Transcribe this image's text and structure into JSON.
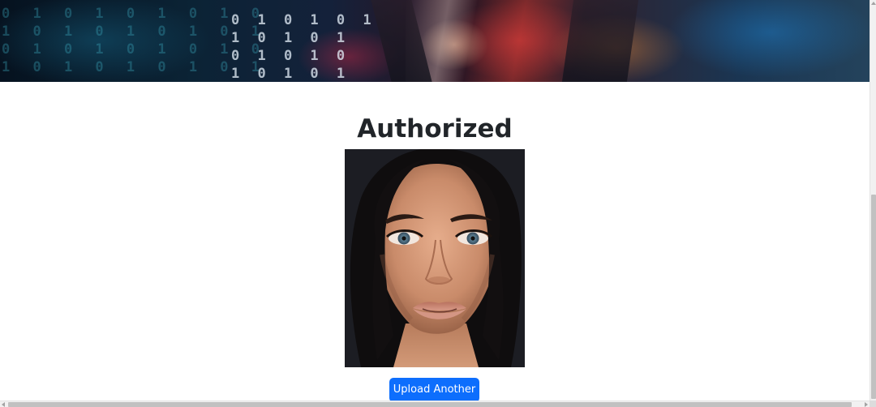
{
  "hero": {
    "digits_left": "0 1 0 1 0 1 0 1 0\n1 0 1 0 1 0 1 0 1\n0 1 0 1 0 1 0 1 0\n1 0 1 0 1 0 1 0 1",
    "digits_center": "0 1 0 1 0 1\n1 0 1 0 1\n0 1 0 1 0\n1 0 1 0 1"
  },
  "result": {
    "title": "Authorized"
  },
  "actions": {
    "upload_another_label": "Upload Another"
  },
  "colors": {
    "primary_button": "#0d6efd",
    "title_text": "#212529",
    "page_background": "#ffffff"
  },
  "icons": {
    "scroll_up": "triangle-up-icon",
    "scroll_left": "triangle-left-icon",
    "scroll_right": "triangle-right-icon"
  }
}
